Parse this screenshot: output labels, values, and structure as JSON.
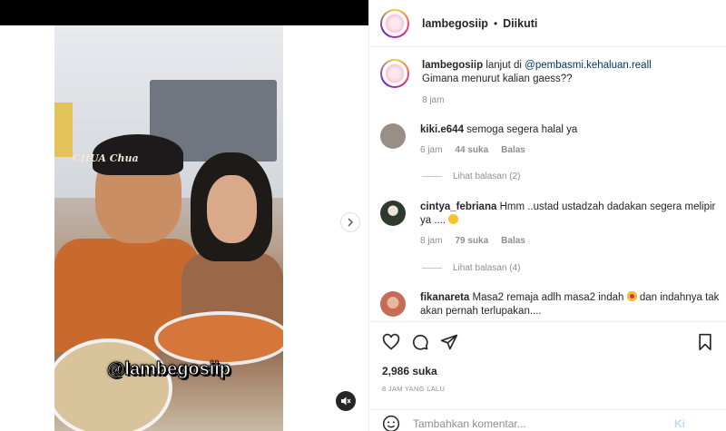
{
  "post": {
    "username": "lambegosiip",
    "separator": "•",
    "follow_status": "Diikuti",
    "caption_mention": "@pembasmi.kehaluan.reall",
    "caption_prefix": "lanjut di",
    "caption_text": "Gimana menurut kalian gaess??",
    "caption_time": "8 jam",
    "video_watermark": "@lambegosiip",
    "shirt_text": "CHUA Chua"
  },
  "comments": [
    {
      "username": "kiki.e644",
      "text": "semoga segera halal ya",
      "time": "6 jam",
      "likes": "44 suka",
      "reply": "Balas",
      "view_replies": "Lihat balasan (2)",
      "avatar_color": "#9a8f86"
    },
    {
      "username": "cintya_febriana",
      "text": "Hmm ..ustad ustadzah dadakan segera melipir ya ....",
      "time": "8 jam",
      "likes": "79 suka",
      "reply": "Balas",
      "view_replies": "Lihat balasan (4)",
      "avatar_color": "#2e3a2f",
      "emoji": "grimace-emoji"
    },
    {
      "username": "fikanareta",
      "text_part1": "Masa2 remaja adlh masa2 indah",
      "text_part2": "dan indahnya tak akan pernah terlupakan....",
      "avatar_color": "#c76b55",
      "emoji": "heart-eyes-emoji"
    }
  ],
  "actions": {
    "likes": "2,986 suka",
    "time_ago": "8 JAM YANG LALU",
    "comment_placeholder": "Tambahkan komentar...",
    "post_label": "Ki"
  },
  "colors": {
    "text": "#262626",
    "secondary": "#8e8e8e",
    "accent_link": "#00376b",
    "border": "#efefef"
  }
}
